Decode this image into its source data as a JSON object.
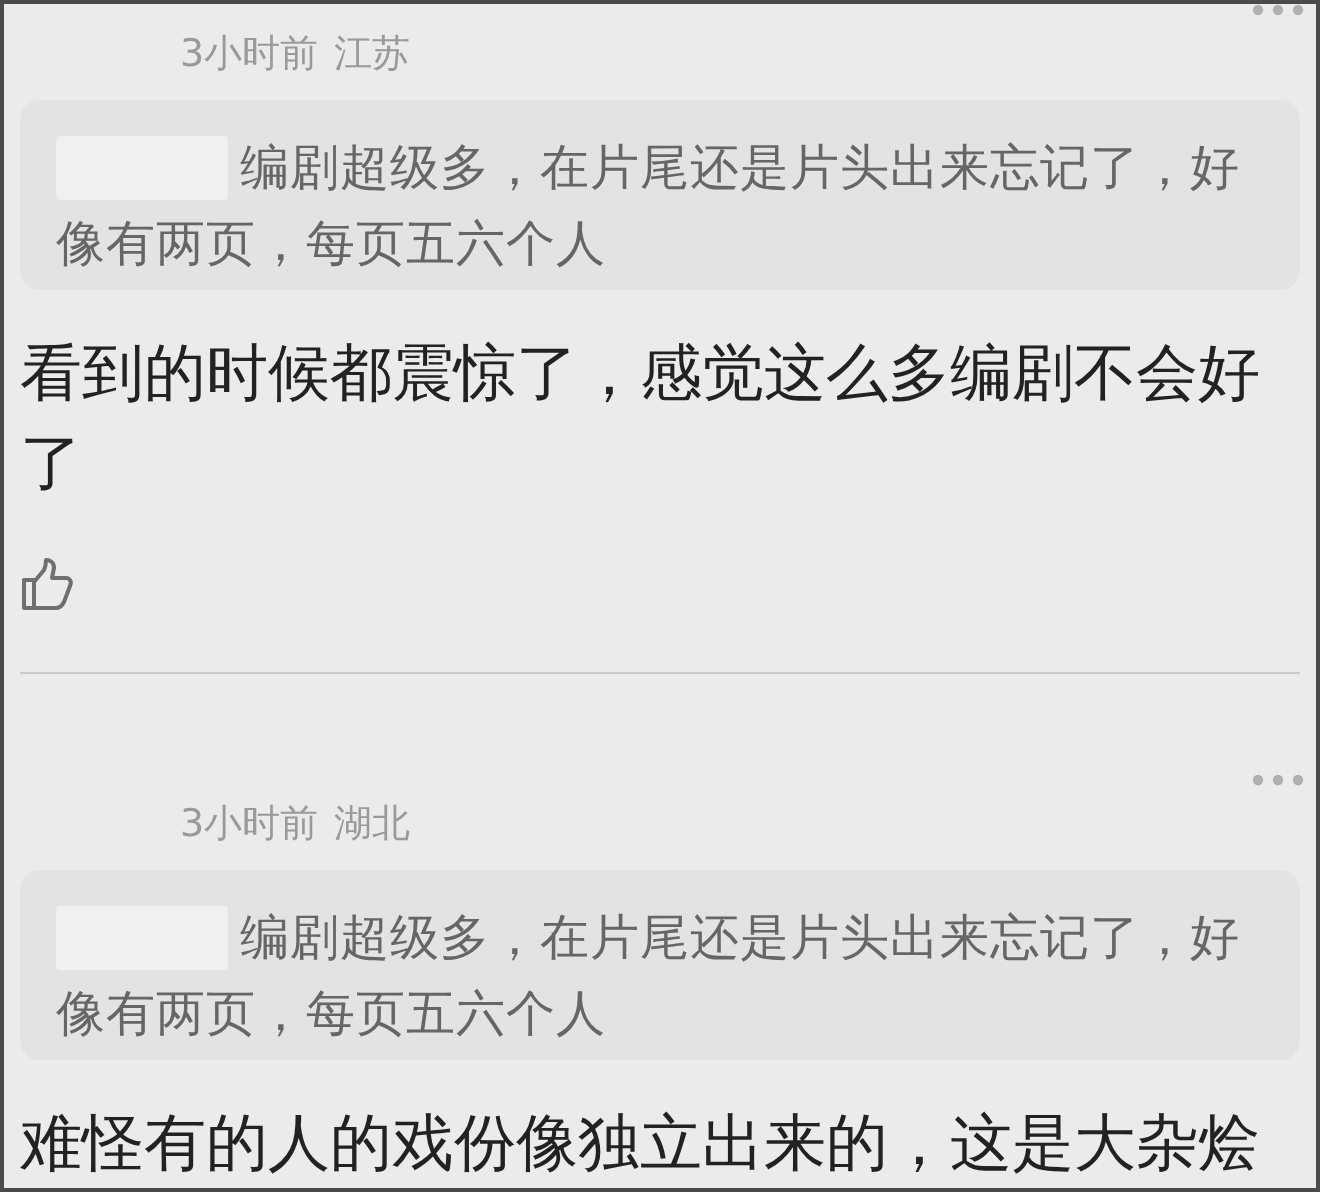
{
  "comments": [
    {
      "time": "3小时前",
      "location": "江苏",
      "quote_lines": [
        "编剧超级多，在片尾还是片头出来忘记了，好",
        "像有两页，每页五六个人"
      ],
      "text": "看到的时候都震惊了，感觉这么多编剧不会好了",
      "like_button": true
    },
    {
      "time": "3小时前",
      "location": "湖北",
      "quote_lines": [
        "编剧超级多，在片尾还是片头出来忘记了，好",
        "像有两页，每页五六个人"
      ],
      "text": "难怪有的人的戏份像独立出来的，这是大杂烩"
    }
  ]
}
